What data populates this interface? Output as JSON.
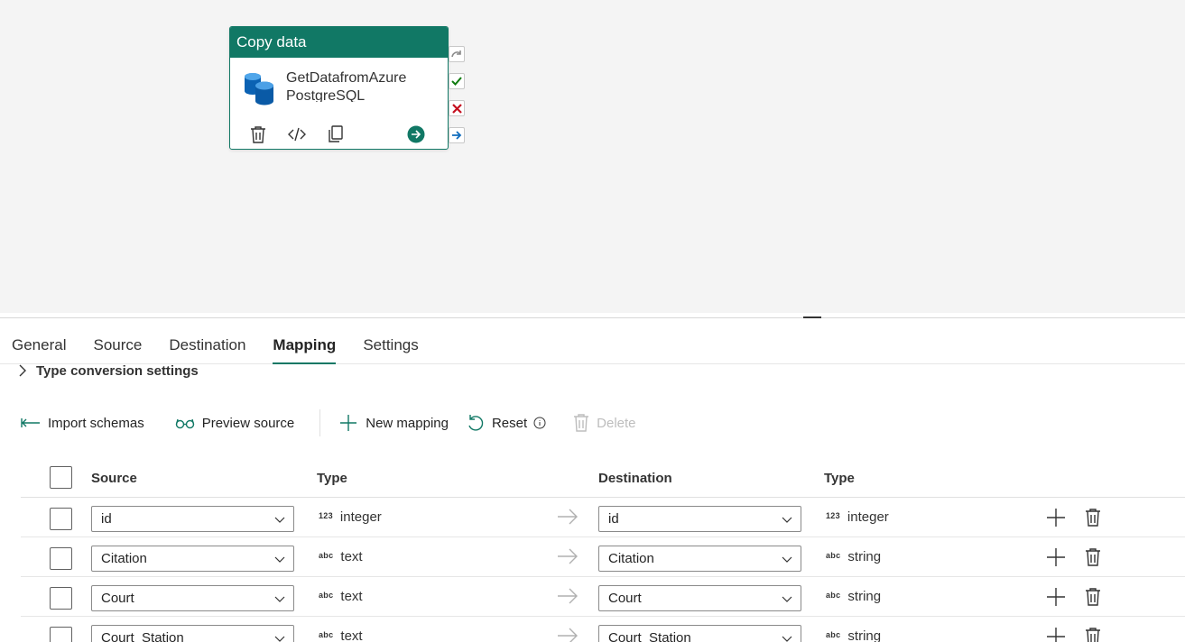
{
  "activity": {
    "title": "Copy data",
    "name": "GetDatafromAzure PostgreSQL",
    "icon": "azure-postgresql-icon",
    "accent": "#117865"
  },
  "tabs": [
    {
      "label": "General",
      "active": false
    },
    {
      "label": "Source",
      "active": false
    },
    {
      "label": "Destination",
      "active": false
    },
    {
      "label": "Mapping",
      "active": true
    },
    {
      "label": "Settings",
      "active": false
    }
  ],
  "type_conversion": {
    "label": "Type conversion settings"
  },
  "toolbar": {
    "import_schemas": "Import schemas",
    "preview_source": "Preview source",
    "new_mapping": "New mapping",
    "reset": "Reset",
    "delete": "Delete"
  },
  "table": {
    "headers": {
      "source": "Source",
      "source_type": "Type",
      "destination": "Destination",
      "destination_type": "Type"
    },
    "rows": [
      {
        "source": "id",
        "source_type_badge": "123",
        "source_type": "integer",
        "destination": "id",
        "destination_type_badge": "123",
        "destination_type": "integer"
      },
      {
        "source": "Citation",
        "source_type_badge": "abc",
        "source_type": "text",
        "destination": "Citation",
        "destination_type_badge": "abc",
        "destination_type": "string"
      },
      {
        "source": "Court",
        "source_type_badge": "abc",
        "source_type": "text",
        "destination": "Court",
        "destination_type_badge": "abc",
        "destination_type": "string"
      },
      {
        "source": "Court_Station",
        "source_type_badge": "abc",
        "source_type": "text",
        "destination": "Court_Station",
        "destination_type_badge": "abc",
        "destination_type": "string"
      }
    ]
  }
}
